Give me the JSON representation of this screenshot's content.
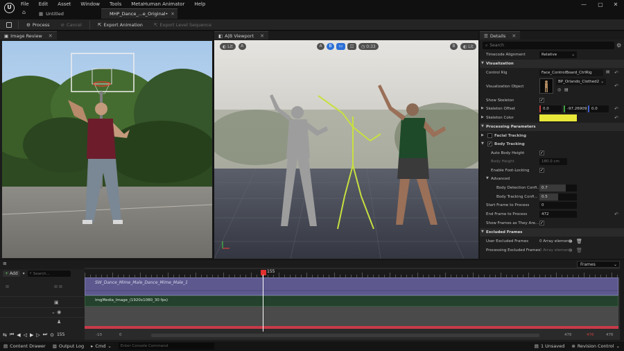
{
  "menu": [
    "File",
    "Edit",
    "Asset",
    "Window",
    "Tools",
    "MetaHuman Animator",
    "Help"
  ],
  "tabs": {
    "untitled": "Untitled",
    "mhp": "MHP_Dance_...e_Original•"
  },
  "toolbar": {
    "process": "Process",
    "cancel": "Cancel",
    "export_animation": "Export Animation",
    "export_level_sequence": "Export Level Sequence"
  },
  "image_review": {
    "tab": "Image Review"
  },
  "viewport": {
    "tab": "A|B Viewport",
    "left_lit": "Lit",
    "a": "A",
    "a2": "A",
    "b": "B",
    "time": "0:33",
    "b2": "B",
    "right_lit": "Lit"
  },
  "details": {
    "tab": "Details",
    "search_placeholder": "Search",
    "rows": {
      "timecode_alignment": {
        "label": "Timecode Alignment",
        "value": "Relative"
      },
      "visualization": "Visualization",
      "control_rig": {
        "label": "Control Rig",
        "value": "Face_ControlBoard_CtrlRig"
      },
      "visualization_object": {
        "label": "Visualization Object",
        "value": "BP_Orlando_Clothed2"
      },
      "show_skeleton": {
        "label": "Show Skeleton"
      },
      "skeleton_offset": {
        "label": "Skeleton Offset",
        "x": "0.0",
        "y": "-97.26909",
        "z": "0.0"
      },
      "skeleton_color": {
        "label": "Skeleton Color"
      },
      "processing_parameters": "Processing Parameters",
      "facial_tracking": "Facial Tracking",
      "body_tracking": "Body Tracking",
      "auto_body_height": {
        "label": "Auto Body Height"
      },
      "body_height": {
        "label": "Body Height",
        "value": "180.0 cm"
      },
      "enable_foot_locking": {
        "label": "Enable Foot-Locking"
      },
      "advanced": "Advanced",
      "body_detection_confidence": {
        "label": "Body Detection Confi...",
        "value": "0.7"
      },
      "body_tracking_confidence": {
        "label": "Body Tracking Confi...",
        "value": "0.5"
      },
      "start_frame": {
        "label": "Start Frame to Process",
        "value": "0"
      },
      "end_frame": {
        "label": "End Frame to Process",
        "value": "472"
      },
      "show_frames_as_they_are": {
        "label": "Show Frames as They Are..."
      },
      "excluded_frames": "Excluded Frames",
      "user_excluded_frames": {
        "label": "User Excluded Frames",
        "value": "0 Array elements"
      },
      "processing_excluded_frames": {
        "label": "Processing Excluded Frames",
        "value": "0 Array elements"
      }
    },
    "skeleton_color_hex": "#e8e83a"
  },
  "sequencer": {
    "add": "Add",
    "search_placeholder": "Search...",
    "current_frame": "155",
    "frames_label": "Frames",
    "track_1": "SW_Dance_Mime_Male_Dance_Mime_Male_1",
    "track_2": "ImgMedia_Image_(1920x1080_30 fps)",
    "start_marker": "-10",
    "start_frame": "0",
    "end_marker_1": "476",
    "end_marker_2": "476",
    "end_marker_3": "476",
    "playback_frame": "155"
  },
  "status": {
    "content_drawer": "Content Drawer",
    "output_log": "Output Log",
    "cmd": "Cmd",
    "console_placeholder": "Enter Console Command",
    "unsaved": "1 Unsaved",
    "revision_control": "Revision Control"
  }
}
